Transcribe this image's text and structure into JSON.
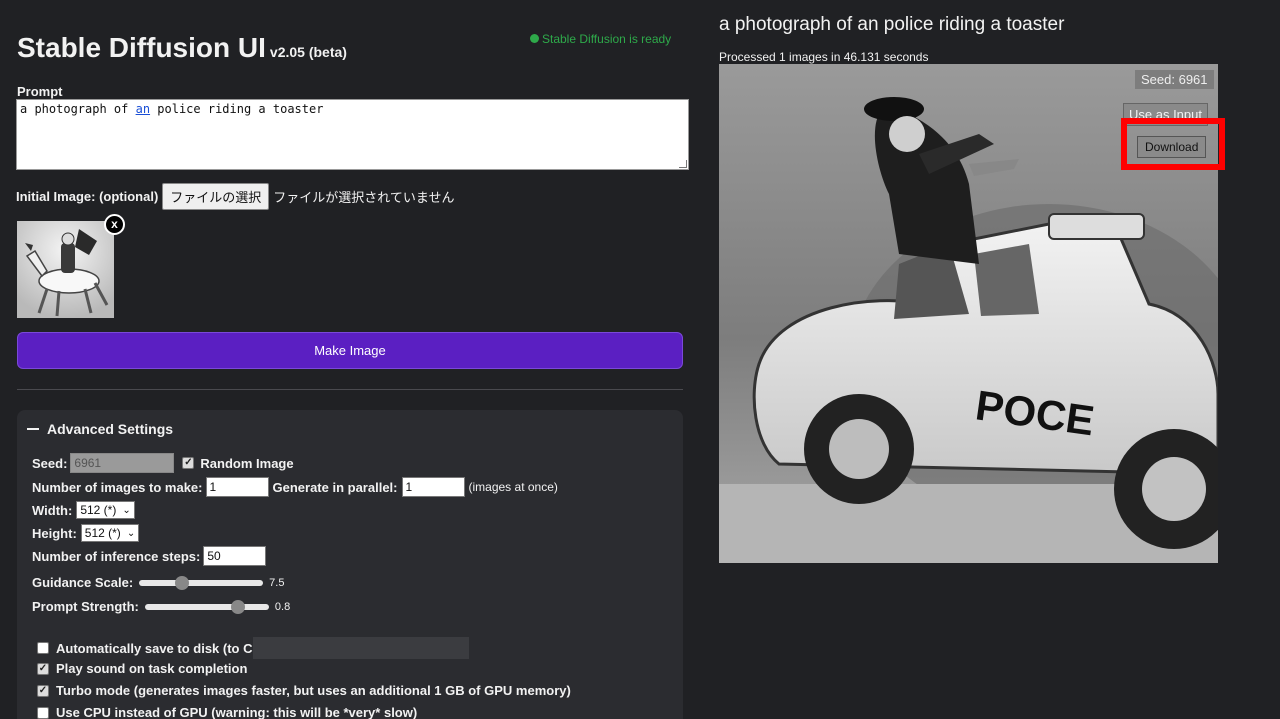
{
  "header": {
    "title": "Stable Diffusion UI",
    "version": "v2.05 (beta)",
    "status_text": "Stable Diffusion is ready",
    "status_color": "#2ea94a"
  },
  "prompt": {
    "label": "Prompt",
    "value_before": "a photograph of ",
    "value_underlined": "an",
    "value_after": " police riding a toaster"
  },
  "initial_image": {
    "label": "Initial Image: (optional)",
    "file_button": "ファイルの選択",
    "file_status": "ファイルが選択されていません",
    "remove_label": "x"
  },
  "make_button": {
    "label": "Make Image",
    "color": "#5b1fc2"
  },
  "settings": {
    "title": "Advanced Settings",
    "seed_label": "Seed:",
    "seed_value": "6961",
    "random_image_label": "Random Image",
    "random_image_checked": true,
    "num_images_label": "Number of images to make:",
    "num_images_value": "1",
    "parallel_label": "Generate in parallel:",
    "parallel_value": "1",
    "parallel_hint": "(images at once)",
    "width_label": "Width:",
    "width_value": "512 (*)",
    "height_label": "Height:",
    "height_value": "512 (*)",
    "steps_label": "Number of inference steps:",
    "steps_value": "50",
    "guidance_label": "Guidance Scale:",
    "guidance_value": "7.5",
    "guidance_fraction": 0.33,
    "strength_label": "Prompt Strength:",
    "strength_value": "0.8",
    "strength_fraction": 0.78,
    "save_disk_label": "Automatically save to disk (to C",
    "save_disk_checked": false,
    "play_sound_label": "Play sound on task completion",
    "play_sound_checked": true,
    "turbo_label": "Turbo mode (generates images faster, but uses an additional 1 GB of GPU memory)",
    "turbo_checked": true,
    "cpu_label": "Use CPU instead of GPU (warning: this will be *very* slow)",
    "cpu_checked": false
  },
  "output": {
    "title": "a photograph of an police riding a toaster",
    "meta": "Processed 1 images in 46.131 seconds",
    "seed_tag": "Seed: 6961",
    "use_input_label": "Use as Input",
    "download_label": "Download",
    "car_text": "POCE",
    "highlight_color": "#ff0000"
  }
}
